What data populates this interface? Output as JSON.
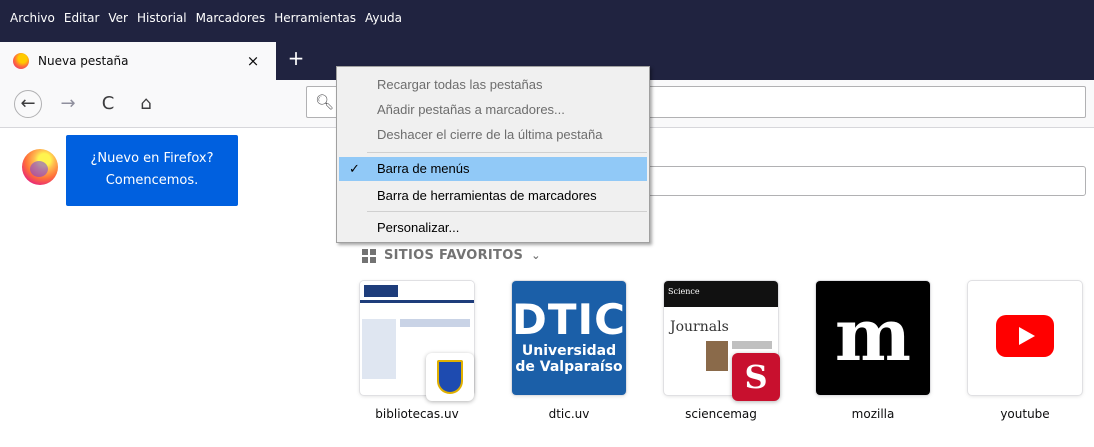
{
  "menubar": {
    "items": [
      "Archivo",
      "Editar",
      "Ver",
      "Historial",
      "Marcadores",
      "Herramientas",
      "Ayuda"
    ]
  },
  "tabs": {
    "active_title": "Nueva pestaña",
    "close_glyph": "×",
    "new_tab_glyph": "+"
  },
  "navbar": {
    "back_glyph": "←",
    "forward_glyph": "→",
    "reload_glyph": "C",
    "home_glyph": "⌂",
    "search_glyph": "🔍︎"
  },
  "promo": {
    "line1": "¿Nuevo en Firefox?",
    "line2": "Comencemos."
  },
  "top_sites": {
    "heading": "SITIOS FAVORITOS",
    "chevron": "⌄",
    "sites": [
      {
        "label": "bibliotecas.uv"
      },
      {
        "label": "dtic.uv",
        "tile_text": "DTIC",
        "tile_sub1": "Universidad",
        "tile_sub2": "de Valparaíso"
      },
      {
        "label": "sciencemag",
        "tile_header": "Science",
        "tile_text": "Journals",
        "badge": "S"
      },
      {
        "label": "mozilla",
        "tile_text": "m"
      },
      {
        "label": "youtube"
      }
    ]
  },
  "context_menu": {
    "items": [
      {
        "label": "Recargar todas las pestañas",
        "disabled": true
      },
      {
        "label": "Añadir pestañas a marcadores...",
        "disabled": true
      },
      {
        "label": "Deshacer el cierre de la última pestaña",
        "disabled": true
      },
      {
        "label": "Barra de menús",
        "checked": true,
        "highlighted": true
      },
      {
        "label": "Barra de herramientas de marcadores"
      },
      {
        "label": "Personalizar..."
      }
    ],
    "check_glyph": "✓"
  },
  "colors": {
    "menubar_bg": "#202340",
    "promo_bg": "#0060df",
    "menu_highlight": "#91c9f7",
    "dtic_blue": "#1b5fa8",
    "youtube_red": "#ff0000"
  }
}
